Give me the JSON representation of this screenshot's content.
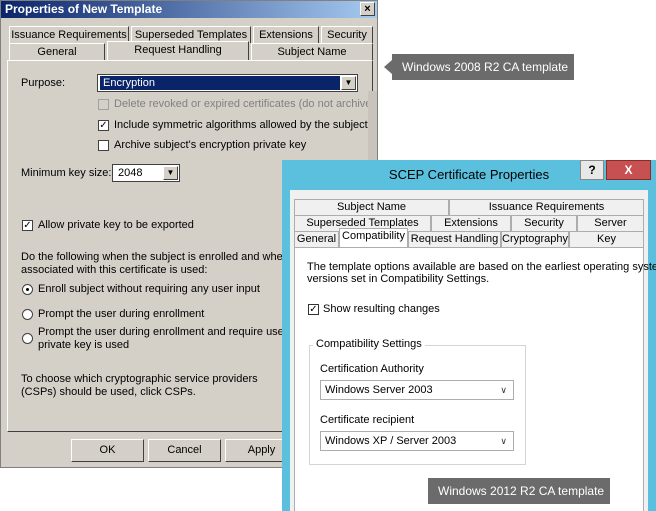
{
  "old_dialog": {
    "title": "Properties of New Template",
    "close": "×",
    "tabs_row1": [
      "Issuance Requirements",
      "Superseded Templates",
      "Extensions",
      "Security"
    ],
    "tabs_row2": [
      "General",
      "Request Handling",
      "Subject Name"
    ],
    "purpose_label": "Purpose:",
    "purpose_value": "Encryption",
    "opt_delete": "Delete revoked or expired certificates (do not archive)",
    "opt_symmetric": "Include symmetric algorithms allowed by the subject",
    "opt_archive": "Archive subject's encryption private key",
    "min_key_label": "Minimum key size:",
    "min_key_value": "2048",
    "opt_export": "Allow private key to be exported",
    "enroll_desc_1": "Do the following when the subject is enrolled and when the",
    "enroll_desc_2": "associated with this certificate is used:",
    "radio_1": "Enroll subject without requiring any user input",
    "radio_2": "Prompt the user during enrollment",
    "radio_3a": "Prompt the user during enrollment and require user inpu",
    "radio_3b": "private key is used",
    "csp_1": "To choose which cryptographic service providers",
    "csp_2": "(CSPs) should be used, click CSPs.",
    "btn_ok": "OK",
    "btn_cancel": "Cancel",
    "btn_apply": "Apply"
  },
  "callouts": {
    "old": "Windows 2008 R2 CA template",
    "new": "Windows 2012 R2 CA template"
  },
  "new_dialog": {
    "title": "SCEP Certificate Properties",
    "help": "?",
    "close": "X",
    "tabs_row1": [
      "Subject Name",
      "Issuance Requirements"
    ],
    "tabs_row2": [
      "Superseded Templates",
      "Extensions",
      "Security",
      "Server"
    ],
    "tabs_row3": [
      "General",
      "Compatibility",
      "Request Handling",
      "Cryptography",
      "Key Attestation"
    ],
    "desc_1": "The template options available are based on the earliest operating system",
    "desc_2": "versions set in Compatibility Settings.",
    "show_changes": "Show resulting changes",
    "group_label": "Compatibility Settings",
    "ca_label": "Certification Authority",
    "ca_value": "Windows Server 2003",
    "recipient_label": "Certificate recipient",
    "recipient_value": "Windows XP / Server 2003"
  }
}
